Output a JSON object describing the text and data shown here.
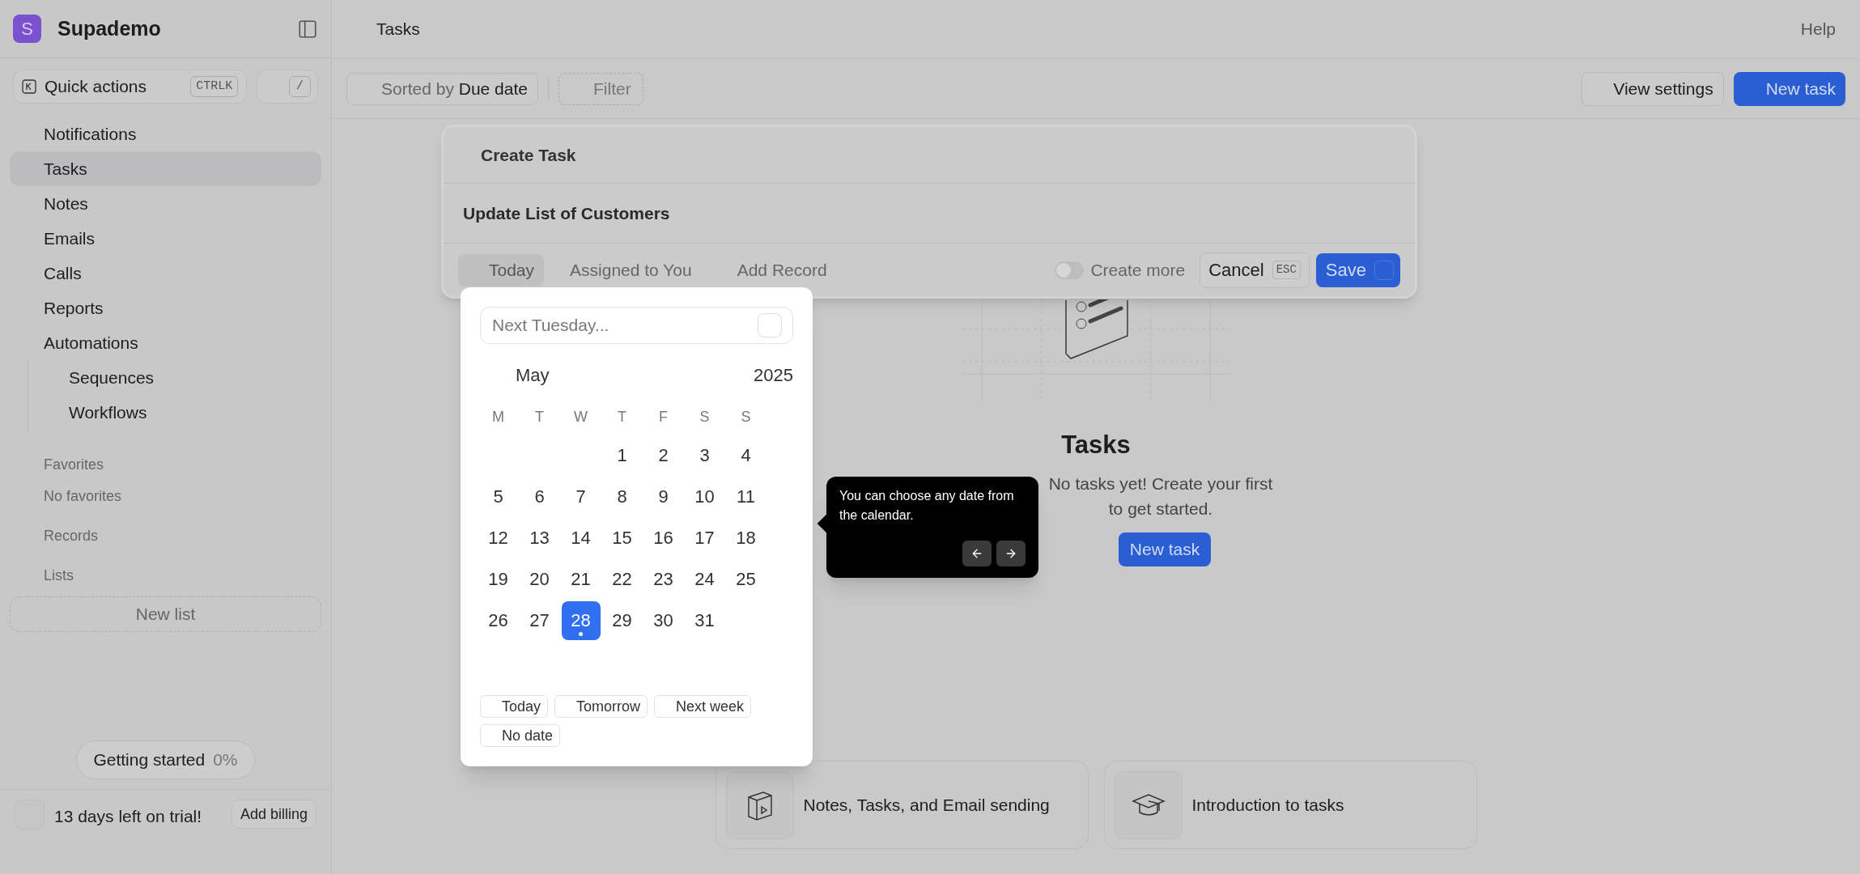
{
  "app": {
    "logo_letter": "S",
    "name": "Supademo"
  },
  "quick_actions": {
    "label": "Quick actions",
    "shortcut": "CTRLK",
    "slash_key": "/"
  },
  "sidebar": {
    "items": [
      {
        "label": "Notifications",
        "selected": false
      },
      {
        "label": "Tasks",
        "selected": true
      },
      {
        "label": "Notes",
        "selected": false
      },
      {
        "label": "Emails",
        "selected": false
      },
      {
        "label": "Calls",
        "selected": false
      },
      {
        "label": "Reports",
        "selected": false
      },
      {
        "label": "Automations",
        "selected": false,
        "children": [
          {
            "label": "Sequences",
            "selected": false
          },
          {
            "label": "Workflows",
            "selected": false
          }
        ]
      }
    ],
    "sections": [
      {
        "title": "Favorites",
        "empty_text": "No favorites"
      },
      {
        "title": "Records"
      },
      {
        "title": "Lists",
        "button": "New list"
      }
    ],
    "progress": {
      "label": "Getting started",
      "value": "0%"
    },
    "trial": {
      "text": "13 days left on trial!",
      "button": "Add billing"
    }
  },
  "header": {
    "title": "Tasks",
    "help": "Help"
  },
  "toolbar": {
    "sort_prefix": "Sorted by",
    "sort_value": "Due date",
    "filter": "Filter",
    "view_settings": "View settings",
    "new_task": "New task"
  },
  "empty_state": {
    "title": "Tasks",
    "lines": [
      "No tasks yet! Create your first",
      "to get started."
    ],
    "button": "New task"
  },
  "cards": [
    {
      "kind": "notebook",
      "label": "Notes, Tasks, and Email sending"
    },
    {
      "kind": "cap",
      "label": "Introduction to tasks"
    }
  ],
  "dialog": {
    "title": "Create Task",
    "task_name": "Update List of Customers",
    "chips": [
      {
        "label": "Today",
        "selected": true
      },
      {
        "label": "Assigned to You",
        "selected": false
      },
      {
        "label": "Add Record",
        "selected": false
      }
    ],
    "create_more": {
      "label": "Create more",
      "on": false
    },
    "cancel": "Cancel",
    "cancel_key": "ESC",
    "save": "Save"
  },
  "date_picker": {
    "placeholder": "Next Tuesday...",
    "month": "May",
    "year": "2025",
    "weekdays": [
      "M",
      "T",
      "W",
      "T",
      "F",
      "S",
      "S"
    ],
    "weeks": [
      [
        {
          "d": "1",
          "selected": false,
          "today": false
        },
        {
          "d": "2",
          "selected": false,
          "today": false
        },
        {
          "d": "3",
          "selected": false,
          "today": false
        },
        {
          "d": "4",
          "selected": false,
          "today": false
        }
      ],
      [
        {
          "d": "5",
          "selected": false,
          "today": false
        },
        {
          "d": "6",
          "selected": false,
          "today": false
        },
        {
          "d": "7",
          "selected": false,
          "today": false
        },
        {
          "d": "8",
          "selected": false,
          "today": false
        },
        {
          "d": "9",
          "selected": false,
          "today": false
        },
        {
          "d": "10",
          "selected": false,
          "today": false
        },
        {
          "d": "11",
          "selected": false,
          "today": false
        }
      ],
      [
        {
          "d": "12",
          "selected": false,
          "today": false
        },
        {
          "d": "13",
          "selected": false,
          "today": false
        },
        {
          "d": "14",
          "selected": false,
          "today": false
        },
        {
          "d": "15",
          "selected": false,
          "today": false
        },
        {
          "d": "16",
          "selected": false,
          "today": false
        },
        {
          "d": "17",
          "selected": false,
          "today": false
        },
        {
          "d": "18",
          "selected": false,
          "today": false
        }
      ],
      [
        {
          "d": "19",
          "selected": false,
          "today": false
        },
        {
          "d": "20",
          "selected": false,
          "today": false
        },
        {
          "d": "21",
          "selected": false,
          "today": false
        },
        {
          "d": "22",
          "selected": false,
          "today": false
        },
        {
          "d": "23",
          "selected": false,
          "today": false
        },
        {
          "d": "24",
          "selected": false,
          "today": false
        },
        {
          "d": "25",
          "selected": false,
          "today": false
        }
      ],
      [
        {
          "d": "26",
          "selected": false,
          "today": false
        },
        {
          "d": "27",
          "selected": false,
          "today": false
        },
        {
          "d": "28",
          "selected": true,
          "today": true
        },
        {
          "d": "29",
          "selected": false,
          "today": false
        },
        {
          "d": "30",
          "selected": false,
          "today": false
        },
        {
          "d": "31",
          "selected": false,
          "today": false
        }
      ]
    ],
    "quick_picks": [
      "Today",
      "Tomorrow",
      "Next week",
      "No date"
    ]
  },
  "tooltip": {
    "text": "You can choose any date from the calendar."
  }
}
